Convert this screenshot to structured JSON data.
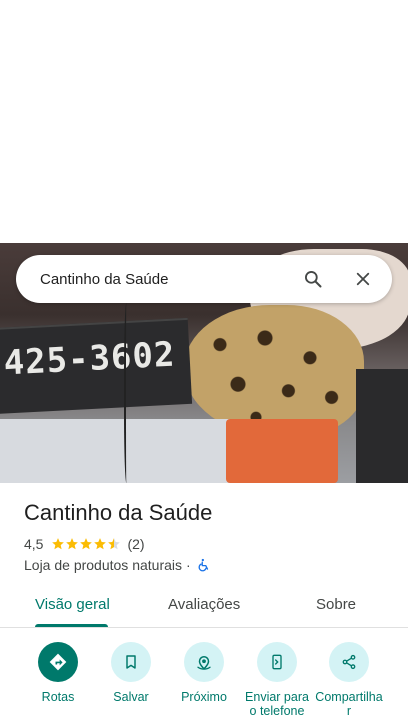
{
  "search": {
    "query": "Cantinho da Saúde"
  },
  "photo": {
    "sign_text": "425-3602"
  },
  "place": {
    "name": "Cantinho da Saúde",
    "rating": "4,5",
    "rating_value": 4.5,
    "rating_max": 5,
    "review_count": "(2)",
    "category": "Loja de produtos naturais",
    "separator": "·"
  },
  "tabs": [
    {
      "label": "Visão geral",
      "active": true
    },
    {
      "label": "Avaliações",
      "active": false
    },
    {
      "label": "Sobre",
      "active": false
    }
  ],
  "actions": [
    {
      "label": "Rotas",
      "icon": "directions-icon",
      "primary": true
    },
    {
      "label": "Salvar",
      "icon": "bookmark-icon",
      "primary": false
    },
    {
      "label": "Próximo",
      "icon": "nearby-icon",
      "primary": false
    },
    {
      "label": "Enviar para o telefone",
      "icon": "send-to-phone-icon",
      "primary": false
    },
    {
      "label": "Compartilhar",
      "icon": "share-icon",
      "primary": false
    }
  ],
  "colors": {
    "accent": "#00796b",
    "action_bg": "#d4f3f5",
    "star": "#fbbc04",
    "wheelchair": "#1a73e8"
  }
}
